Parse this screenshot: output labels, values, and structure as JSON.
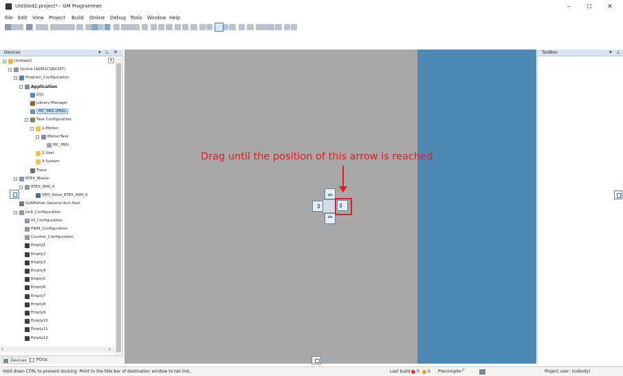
{
  "window": {
    "title": "Untitled2.project* - GM Programmer",
    "minimize": "–",
    "maximize": "☐",
    "close": "✕"
  },
  "menu": [
    "File",
    "Edit",
    "View",
    "Project",
    "Build",
    "Online",
    "Debug",
    "Tools",
    "Window",
    "Help"
  ],
  "devices_panel": {
    "title": "Devices",
    "header_buttons": "▾ ⊥ ✕",
    "tree": [
      {
        "label": "Untitled2",
        "depth": 0,
        "icon": "project-icon",
        "exp": true
      },
      {
        "label": "Device (AGM1CSRX16T)",
        "depth": 1,
        "icon": "device-icon",
        "exp": true
      },
      {
        "label": "Program_Configuration",
        "depth": 2,
        "icon": "plc-logic-icon",
        "exp": true
      },
      {
        "label": "Application",
        "depth": 3,
        "icon": "application-icon",
        "exp": true,
        "bold": true
      },
      {
        "label": "GVL",
        "depth": 4,
        "icon": "gvl-icon"
      },
      {
        "label": "Library Manager",
        "depth": 4,
        "icon": "library-icon"
      },
      {
        "label": "MC_PRG (PRG)",
        "depth": 4,
        "icon": "prg-icon",
        "selected": true
      },
      {
        "label": "Task Configuration",
        "depth": 4,
        "icon": "task-config-icon",
        "exp": true
      },
      {
        "label": "1.Motion",
        "depth": 5,
        "icon": "folder-icon",
        "exp": true
      },
      {
        "label": "MotionTask",
        "depth": 6,
        "icon": "task-icon",
        "exp": true
      },
      {
        "label": "MC_PRG",
        "depth": 7,
        "icon": "prg-call-icon"
      },
      {
        "label": "2.User",
        "depth": 5,
        "icon": "folder-icon"
      },
      {
        "label": "3.System",
        "depth": 5,
        "icon": "folder-icon"
      },
      {
        "label": "Trace",
        "depth": 4,
        "icon": "trace-icon"
      },
      {
        "label": "RTEX_Master",
        "depth": 2,
        "icon": "device-icon",
        "exp": true
      },
      {
        "label": "RTEX_A6N_0",
        "depth": 3,
        "icon": "device-icon",
        "exp": true
      },
      {
        "label": "SM3_Drive_RTEX_A6N_0",
        "depth": 5,
        "icon": "drive-icon"
      },
      {
        "label": "SoftMotion General Axis Pool",
        "depth": 2,
        "icon": "axis-pool-icon"
      },
      {
        "label": "Unit_Configuration",
        "depth": 2,
        "icon": "device-icon",
        "exp": true
      },
      {
        "label": "IO_Configuration",
        "depth": 3,
        "icon": "device-icon"
      },
      {
        "label": "PWM_Configuration",
        "depth": 3,
        "icon": "device-icon"
      },
      {
        "label": "Counter_Configuration",
        "depth": 3,
        "icon": "device-icon"
      },
      {
        "label": "Empty1",
        "depth": 3,
        "icon": "slot-icon"
      },
      {
        "label": "Empty2",
        "depth": 3,
        "icon": "slot-icon"
      },
      {
        "label": "Empty3",
        "depth": 3,
        "icon": "slot-icon"
      },
      {
        "label": "Empty4",
        "depth": 3,
        "icon": "slot-icon"
      },
      {
        "label": "Empty5",
        "depth": 3,
        "icon": "slot-icon"
      },
      {
        "label": "Empty6",
        "depth": 3,
        "icon": "slot-icon"
      },
      {
        "label": "Empty7",
        "depth": 3,
        "icon": "slot-icon"
      },
      {
        "label": "Empty8",
        "depth": 3,
        "icon": "slot-icon"
      },
      {
        "label": "Empty9",
        "depth": 3,
        "icon": "slot-icon"
      },
      {
        "label": "Empty10",
        "depth": 3,
        "icon": "slot-icon"
      },
      {
        "label": "Empty11",
        "depth": 3,
        "icon": "slot-icon"
      },
      {
        "label": "Empty12",
        "depth": 3,
        "icon": "slot-icon"
      }
    ],
    "tabs": [
      "Devices",
      "POUs"
    ]
  },
  "instruction": "Drag until the position of this arrow is reached",
  "toolbox": {
    "title": "ToolBox",
    "header_buttons": "▾ ⊥"
  },
  "status": {
    "hint": "Hold down CTRL to prevent docking. Point to the title bar of destination window to tab link.",
    "last_build_label": "Last build:",
    "errors": "0",
    "warnings": "0",
    "precompile_label": "Precompile",
    "project_user": "Project user: (nobody)"
  },
  "colors": {
    "accent": "#e11c1c",
    "dock_preview": "#4f8ab7",
    "editor_bg": "#a8a8a8"
  }
}
